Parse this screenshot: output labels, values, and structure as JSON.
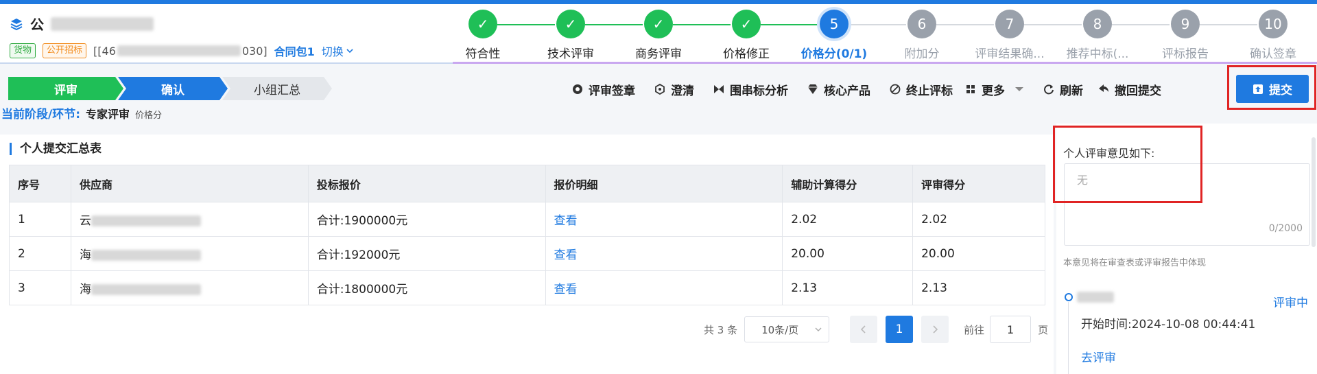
{
  "header": {
    "title": "公",
    "tags": [
      "货物",
      "公开招标"
    ],
    "code_prefix": "[[46",
    "code_suffix": "030]",
    "package": "合同包1",
    "switch_label": "切换"
  },
  "steps": [
    {
      "num": "",
      "label": "符合性",
      "state": "done"
    },
    {
      "num": "",
      "label": "技术评审",
      "state": "done"
    },
    {
      "num": "",
      "label": "商务评审",
      "state": "done"
    },
    {
      "num": "",
      "label": "价格修正",
      "state": "done"
    },
    {
      "num": "5",
      "label": "价格分(0/1)",
      "state": "current"
    },
    {
      "num": "6",
      "label": "附加分",
      "state": "todo"
    },
    {
      "num": "7",
      "label": "评审结果确...",
      "state": "todo"
    },
    {
      "num": "8",
      "label": "推荐中标(...",
      "state": "todo"
    },
    {
      "num": "9",
      "label": "评标报告",
      "state": "todo"
    },
    {
      "num": "10",
      "label": "确认签章",
      "state": "todo"
    }
  ],
  "flow": {
    "review": "评审",
    "confirm": "确认",
    "summary": "小组汇总"
  },
  "stage": {
    "key": "当前阶段/环节:",
    "value": "专家评审",
    "sub": "价格分"
  },
  "toolbar": {
    "sign": "评审签章",
    "clarify": "澄清",
    "bid_analysis": "围串标分析",
    "core_product": "核心产品",
    "terminate": "终止评标",
    "more": "更多",
    "refresh": "刷新",
    "withdraw": "撤回提交",
    "submit": "提交"
  },
  "section_title": "个人提交汇总表",
  "table": {
    "headers": [
      "序号",
      "供应商",
      "投标报价",
      "报价明细",
      "辅助计算得分",
      "评审得分"
    ],
    "rows": [
      {
        "no": "1",
        "supplier": "云",
        "price": "合计:1900000元",
        "detail": "查看",
        "aux": "2.02",
        "score": "2.02"
      },
      {
        "no": "2",
        "supplier": "海",
        "price": "合计:192000元",
        "detail": "查看",
        "aux": "20.00",
        "score": "20.00"
      },
      {
        "no": "3",
        "supplier": "海",
        "price": "合计:1800000元",
        "detail": "查看",
        "aux": "2.13",
        "score": "2.13"
      }
    ]
  },
  "pager": {
    "total": "共 3 条",
    "page_size": "10条/页",
    "current": "1",
    "goto_label": "前往",
    "goto_value": "1",
    "page_unit": "页"
  },
  "right_panel": {
    "label": "个人评审意见如下:",
    "placeholder": "无",
    "counter": "0/2000",
    "hint": "本意见将在审查表或评审报告中体现",
    "status": "评审中",
    "start_time": "开始时间:2024-10-08 00:44:41",
    "go_review": "去评审"
  },
  "colors": {
    "primary": "#1f7ae0",
    "success": "#1fbf57",
    "pending": "#9aa1ab",
    "highlight": "#e02424"
  }
}
